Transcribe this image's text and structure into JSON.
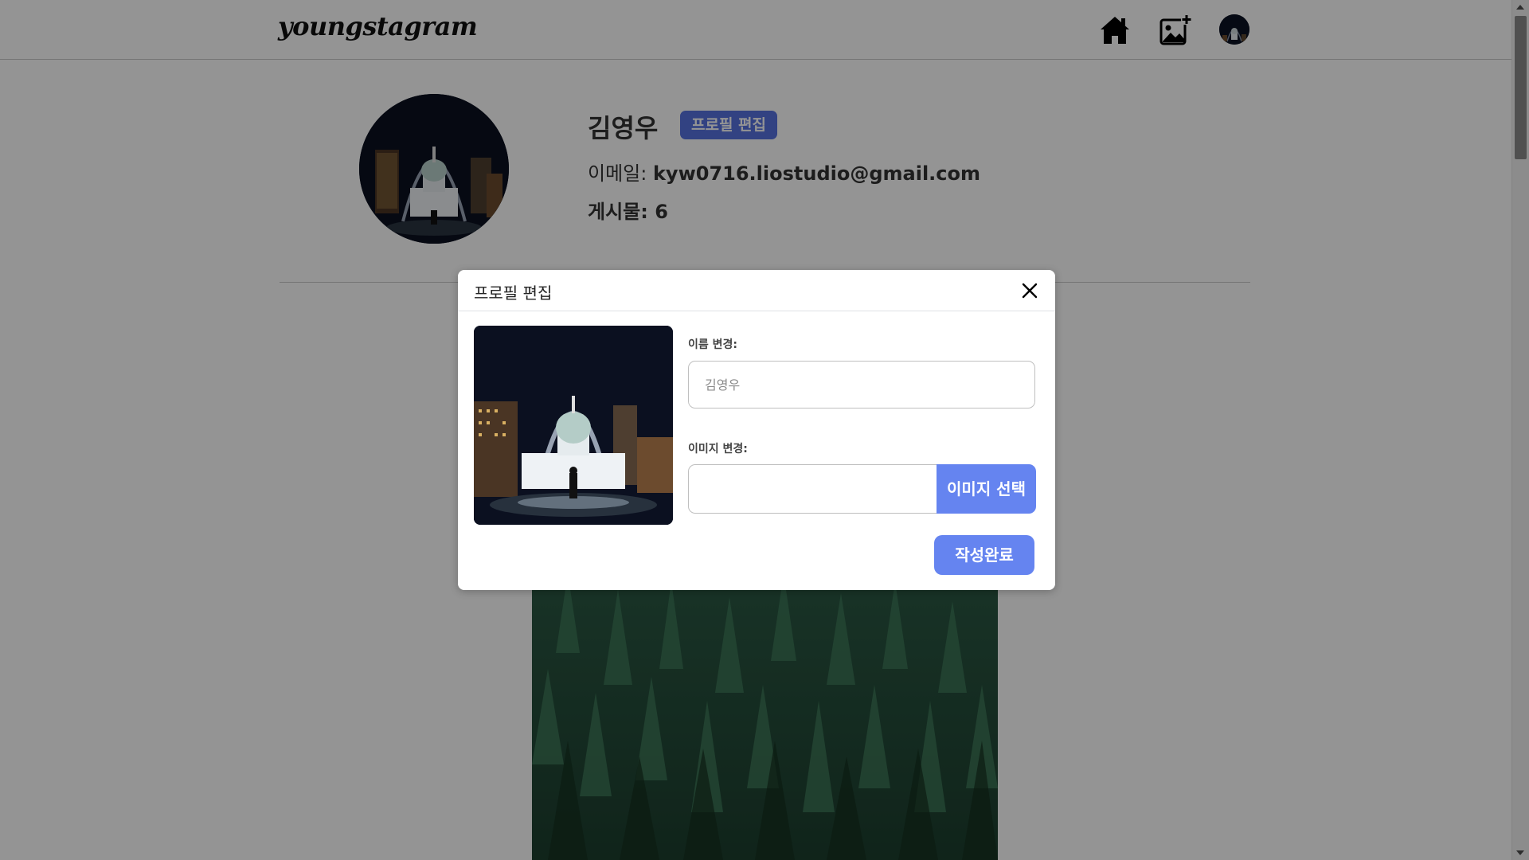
{
  "app": {
    "logo": "youngstagram"
  },
  "nav": {
    "home_icon": "home-icon",
    "add_post_icon": "add-image-icon",
    "avatar": "user-avatar"
  },
  "profile": {
    "name": "김영우",
    "edit_button": "프로필 편집",
    "email_label": "이메일: ",
    "email_value": "kyw0716.liostudio@gmail.com",
    "posts_label": "게시물: 6"
  },
  "modal": {
    "title": "프로필 편집",
    "close_icon": "close-icon",
    "name_label": "이름 변경:",
    "name_placeholder": "김영우",
    "name_value": "",
    "image_label": "이미지 변경:",
    "image_button": "이미지 선택",
    "submit_button": "작성완료"
  },
  "colors": {
    "accent": "#6584f0",
    "badge": "#5673e0",
    "overlay": "rgba(0,0,0,0.42)"
  }
}
